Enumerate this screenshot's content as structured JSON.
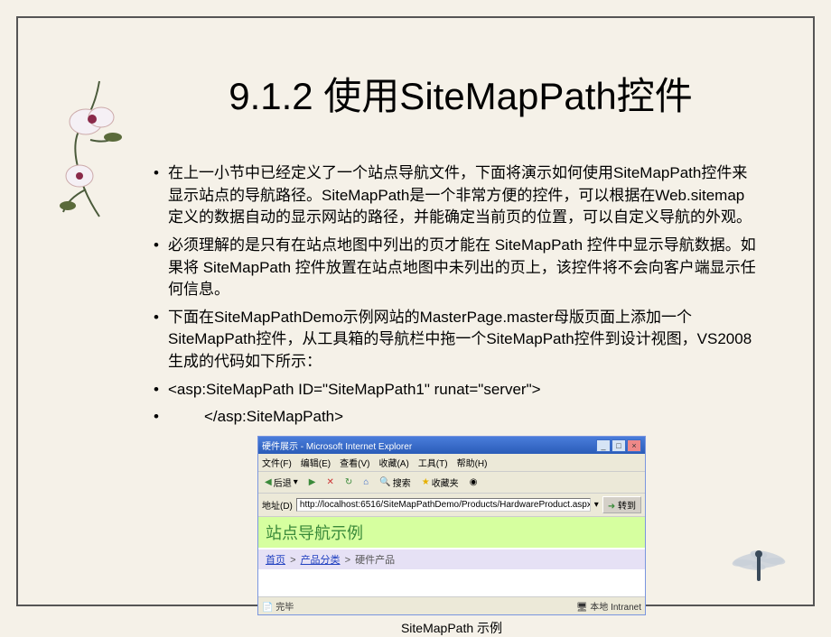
{
  "title": "9.1.2  使用SiteMapPath控件",
  "bullets": [
    "在上一小节中已经定义了一个站点导航文件，下面将演示如何使用SiteMapPath控件来显示站点的导航路径。SiteMapPath是一个非常方便的控件，可以根据在Web.sitemap定义的数据自动的显示网站的路径，并能确定当前页的位置，可以自定义导航的外观。",
    "必须理解的是只有在站点地图中列出的页才能在 SiteMapPath 控件中显示导航数据。如果将 SiteMapPath 控件放置在站点地图中未列出的页上，该控件将不会向客户端显示任何信息。",
    "下面在SiteMapPathDemo示例网站的MasterPage.master母版页面上添加一个SiteMapPath控件，从工具箱的导航栏中拖一个SiteMapPath控件到设计视图，VS2008生成的代码如下所示：",
    "<asp:SiteMapPath ID=\"SiteMapPath1\" runat=\"server\">",
    "        </asp:SiteMapPath>"
  ],
  "ie": {
    "title": "硬件展示 - Microsoft Internet Explorer",
    "menu": [
      "文件(F)",
      "编辑(E)",
      "查看(V)",
      "收藏(A)",
      "工具(T)",
      "帮助(H)"
    ],
    "toolbar": {
      "back": "后退",
      "search": "搜索",
      "fav": "收藏夹"
    },
    "address_label": "地址(D)",
    "address_value": "http://localhost:6516/SiteMapPathDemo/Products/HardwareProduct.aspx",
    "go_label": "转到",
    "page_header": "站点导航示例",
    "breadcrumb": {
      "home": "首页",
      "sep": ">",
      "cat": "产品分类",
      "current": "硬件产品"
    },
    "status_left": "完毕",
    "status_right": "本地 Intranet"
  },
  "caption": "SiteMapPath 示例"
}
